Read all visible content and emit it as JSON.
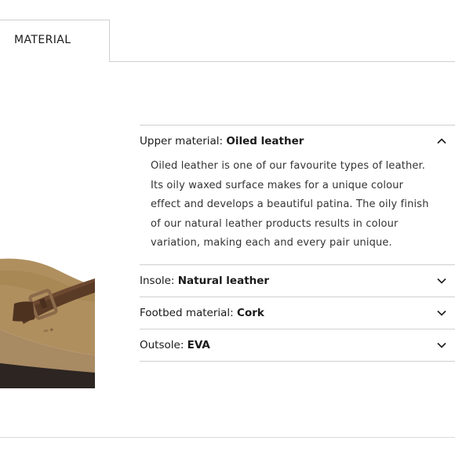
{
  "tabs": {
    "active_label": "MATERIAL"
  },
  "accordion": {
    "items": [
      {
        "label": "Upper material:",
        "value": "Oiled leather",
        "expanded": true,
        "description": "Oiled leather is one of our favourite types of leather. Its oily waxed surface makes for a unique colour effect and develops a beautiful patina. The oily finish of our natural leather products results in colour variation, making each and every pair unique."
      },
      {
        "label": "Insole:",
        "value": "Natural leather",
        "expanded": false
      },
      {
        "label": "Footbed material:",
        "value": "Cork",
        "expanded": false
      },
      {
        "label": "Outsole:",
        "value": "EVA",
        "expanded": false
      }
    ]
  },
  "colors": {
    "divider": "#cfcfcf",
    "text": "#1a1a1a",
    "body_text": "#333333"
  },
  "icons": {
    "collapse": "chevron-up-icon",
    "expand": "chevron-down-icon"
  }
}
